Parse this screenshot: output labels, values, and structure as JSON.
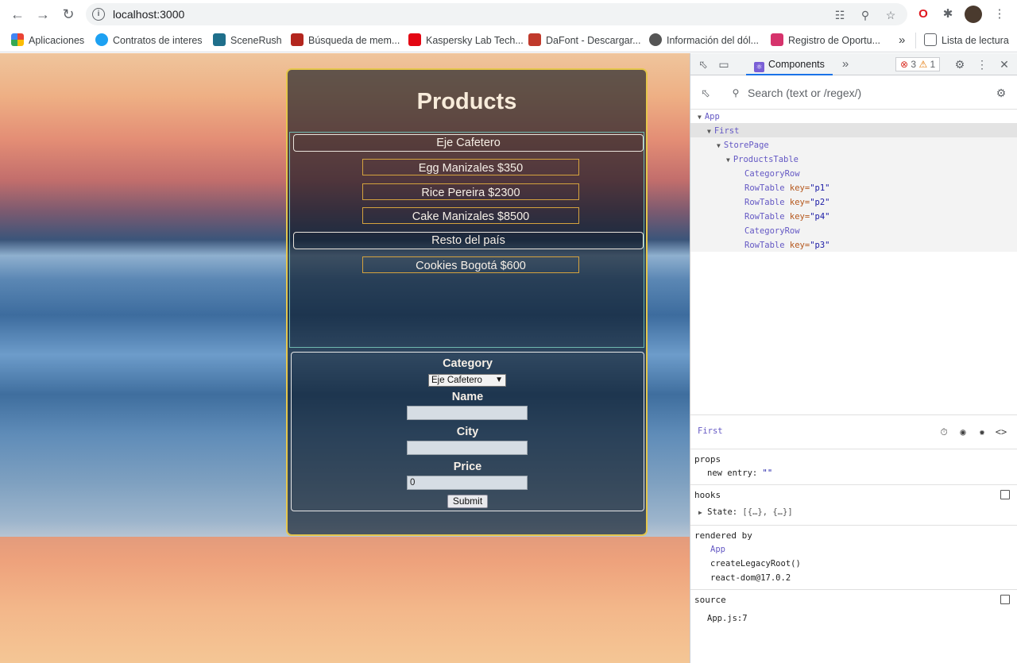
{
  "browser": {
    "url": "localhost:3000",
    "bookmarks": [
      {
        "label": "Aplicaciones",
        "icon": "apps-grid-icon",
        "color": "#4285f4"
      },
      {
        "label": "Contratos de interes",
        "icon": "contract-icon",
        "color": "#1da1f2"
      },
      {
        "label": "SceneRush",
        "icon": "scenerush-icon",
        "color": "#1f6f8b"
      },
      {
        "label": "Búsqueda de mem...",
        "icon": "search-mem-icon",
        "color": "#c0392b"
      },
      {
        "label": "Kaspersky Lab Tech...",
        "icon": "kaspersky-icon",
        "color": "#e30613"
      },
      {
        "label": "DaFont - Descargar...",
        "icon": "dafont-icon",
        "color": "#c0392b"
      },
      {
        "label": "Información del dól...",
        "icon": "globe-icon",
        "color": "#555555"
      },
      {
        "label": "Registro de Oportu...",
        "icon": "registro-icon",
        "color": "#d6336c"
      }
    ],
    "more_bookmarks": "»",
    "reading_list": "Lista de lectura"
  },
  "app": {
    "title": "Products",
    "categories": [
      {
        "name": "Eje Cafetero",
        "products": [
          "Egg Manizales $350",
          "Rice Pereira $2300",
          "Cake Manizales $8500"
        ]
      },
      {
        "name": "Resto del país",
        "products": [
          "Cookies Bogotá $600"
        ]
      }
    ],
    "form": {
      "category_label": "Category",
      "category_value": "Eje Cafetero",
      "name_label": "Name",
      "name_value": "",
      "city_label": "City",
      "city_value": "",
      "price_label": "Price",
      "price_value": "0",
      "submit_label": "Submit"
    }
  },
  "devtools": {
    "tab": "Components",
    "more_tabs": "»",
    "errors": "3",
    "warnings": "1",
    "search_placeholder": "Search (text or /regex/)",
    "tree": {
      "app": "App",
      "first": "First",
      "store_page": "StorePage",
      "products_table": "ProductsTable",
      "category_row_1": "CategoryRow",
      "row1": {
        "name": "RowTable",
        "key": "key=",
        "val": "\"p1\""
      },
      "row2": {
        "name": "RowTable",
        "key": "key=",
        "val": "\"p2\""
      },
      "row3": {
        "name": "RowTable",
        "key": "key=",
        "val": "\"p4\""
      },
      "category_row_2": "CategoryRow",
      "row4": {
        "name": "RowTable",
        "key": "key=",
        "val": "\"p3\""
      }
    },
    "selected": "First",
    "props_title": "props",
    "props_entry_key": "new entry:",
    "props_entry_val": "\"\"",
    "hooks_title": "hooks",
    "hooks_state_key": "State:",
    "hooks_state_val": "[{…}, {…}]",
    "rendered_by_title": "rendered by",
    "rendered_by": [
      "App",
      "createLegacyRoot()",
      "react-dom@17.0.2"
    ],
    "source_title": "source",
    "source_file": "App.js:7"
  }
}
